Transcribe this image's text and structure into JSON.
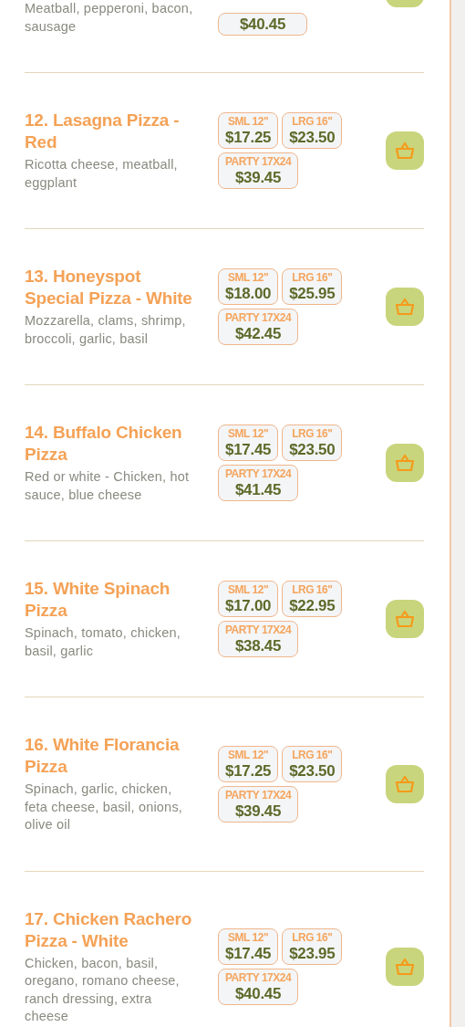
{
  "partial_item": {
    "description": "Meatball, pepperoni, bacon, sausage",
    "price": "$40.45"
  },
  "items": [
    {
      "title": "12. Lasagna Pizza - Red",
      "description": "Ricotta cheese, meatball, eggplant",
      "prices": [
        {
          "size": "SML 12\"",
          "price": "$17.25"
        },
        {
          "size": "LRG 16\"",
          "price": "$23.50"
        },
        {
          "size": "PARTY 17X24",
          "price": "$39.45"
        }
      ]
    },
    {
      "title": "13. Honeyspot Special Pizza - White",
      "description": "Mozzarella, clams, shrimp, broccoli, garlic, basil",
      "prices": [
        {
          "size": "SML 12\"",
          "price": "$18.00"
        },
        {
          "size": "LRG 16\"",
          "price": "$25.95"
        },
        {
          "size": "PARTY 17X24",
          "price": "$42.45"
        }
      ]
    },
    {
      "title": "14. Buffalo Chicken Pizza",
      "description": "Red or white - Chicken, hot sauce, blue cheese",
      "prices": [
        {
          "size": "SML 12\"",
          "price": "$17.45"
        },
        {
          "size": "LRG 16\"",
          "price": "$23.50"
        },
        {
          "size": "PARTY 17X24",
          "price": "$41.45"
        }
      ]
    },
    {
      "title": "15. White Spinach Pizza",
      "description": "Spinach, tomato, chicken, basil, garlic",
      "prices": [
        {
          "size": "SML 12\"",
          "price": "$17.00"
        },
        {
          "size": "LRG 16\"",
          "price": "$22.95"
        },
        {
          "size": "PARTY 17X24",
          "price": "$38.45"
        }
      ]
    },
    {
      "title": "16. White Florancia Pizza",
      "description": "Spinach, garlic, chicken, feta cheese, basil, onions, olive oil",
      "prices": [
        {
          "size": "SML 12\"",
          "price": "$17.25"
        },
        {
          "size": "LRG 16\"",
          "price": "$23.50"
        },
        {
          "size": "PARTY 17X24",
          "price": "$39.45"
        }
      ]
    },
    {
      "title": "17. Chicken Rachero Pizza - White",
      "description": "Chicken, bacon, basil, oregano, romano cheese, ranch dressing, extra cheese",
      "prices": [
        {
          "size": "SML 12\"",
          "price": "$17.45"
        },
        {
          "size": "LRG 16\"",
          "price": "$23.95"
        },
        {
          "size": "PARTY 17X24",
          "price": "$40.45"
        }
      ]
    }
  ]
}
